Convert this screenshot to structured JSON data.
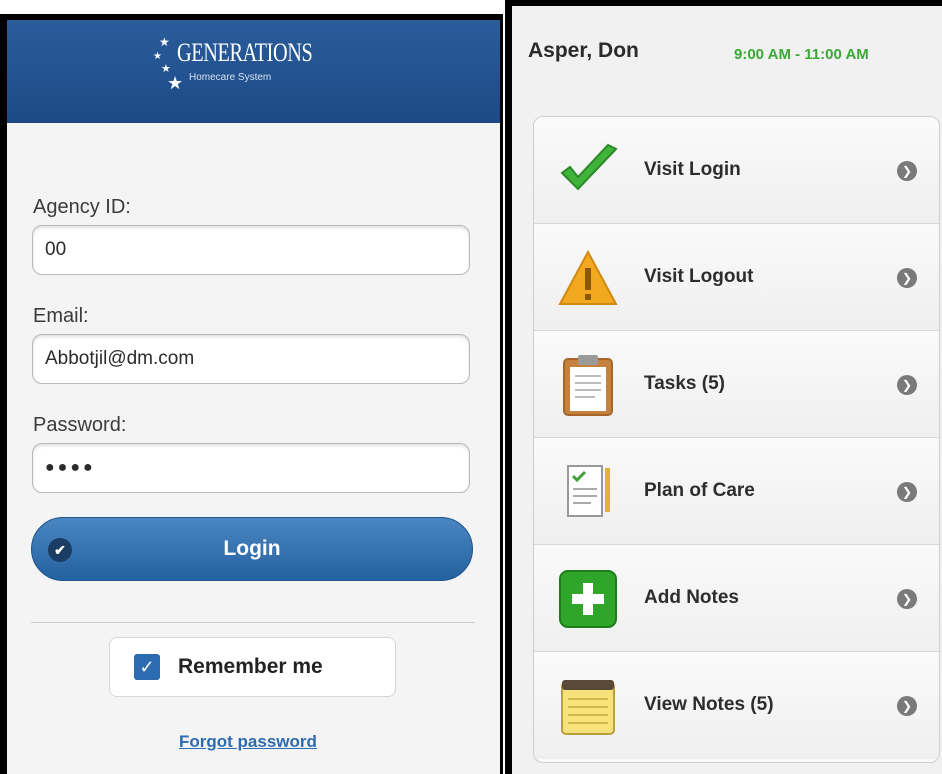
{
  "login_screen": {
    "brand": {
      "title": "GENERATIONS",
      "subtitle": "Homecare System"
    },
    "fields": {
      "agency_label": "Agency ID:",
      "agency_value": "00",
      "email_label": "Email:",
      "email_value": "Abbotjil@dm.com",
      "password_label": "Password:",
      "password_value": "●●●●"
    },
    "login_button_label": "Login",
    "remember_label": "Remember me",
    "remember_checked": true,
    "forgot_label": "Forgot password",
    "colors": {
      "header": "#1d4a86",
      "button": "#2d6bb0"
    }
  },
  "visit_screen": {
    "patient_name": "Asper, Don",
    "visit_time": "9:00 AM  -  11:00 AM",
    "colors": {
      "time": "#3aa935"
    },
    "menu": [
      {
        "label": "Visit Login",
        "icon": "green-checkmark-icon"
      },
      {
        "label": "Visit Logout",
        "icon": "warning-icon"
      },
      {
        "label": "Tasks (5)",
        "icon": "clipboard-icon"
      },
      {
        "label": "Plan of Care",
        "icon": "document-icon"
      },
      {
        "label": "Add Notes",
        "icon": "add-plus-icon"
      },
      {
        "label": "View Notes (5)",
        "icon": "notepad-icon"
      }
    ]
  }
}
